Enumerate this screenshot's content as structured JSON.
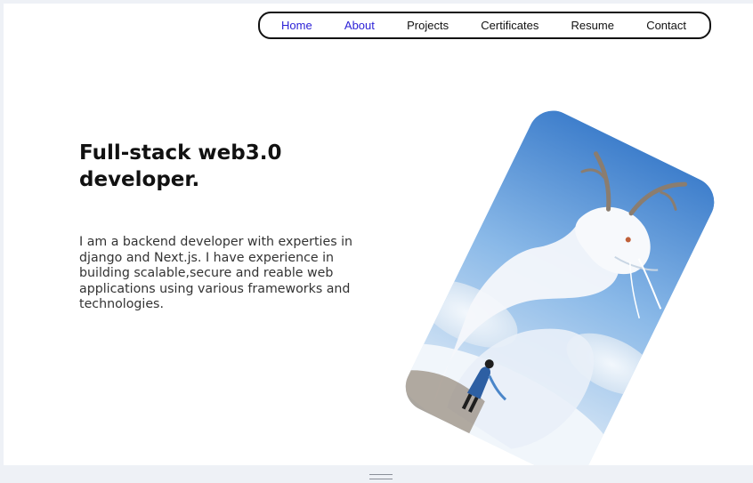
{
  "nav": {
    "items": [
      {
        "label": "Home",
        "active": true
      },
      {
        "label": "About",
        "active": true
      },
      {
        "label": "Projects",
        "active": false
      },
      {
        "label": "Certificates",
        "active": false
      },
      {
        "label": "Resume",
        "active": false
      },
      {
        "label": "Contact",
        "active": false
      }
    ],
    "active_color": "#2a1fd6",
    "text_color": "#111111"
  },
  "hero": {
    "title": "Full-stack web3.0 developer.",
    "description": "I am a backend developer with experties in django and Next.js. I have experience in building scalable,secure and reable web applications using various frameworks and technologies."
  },
  "artwork": {
    "icon": "dragon-illustration"
  }
}
